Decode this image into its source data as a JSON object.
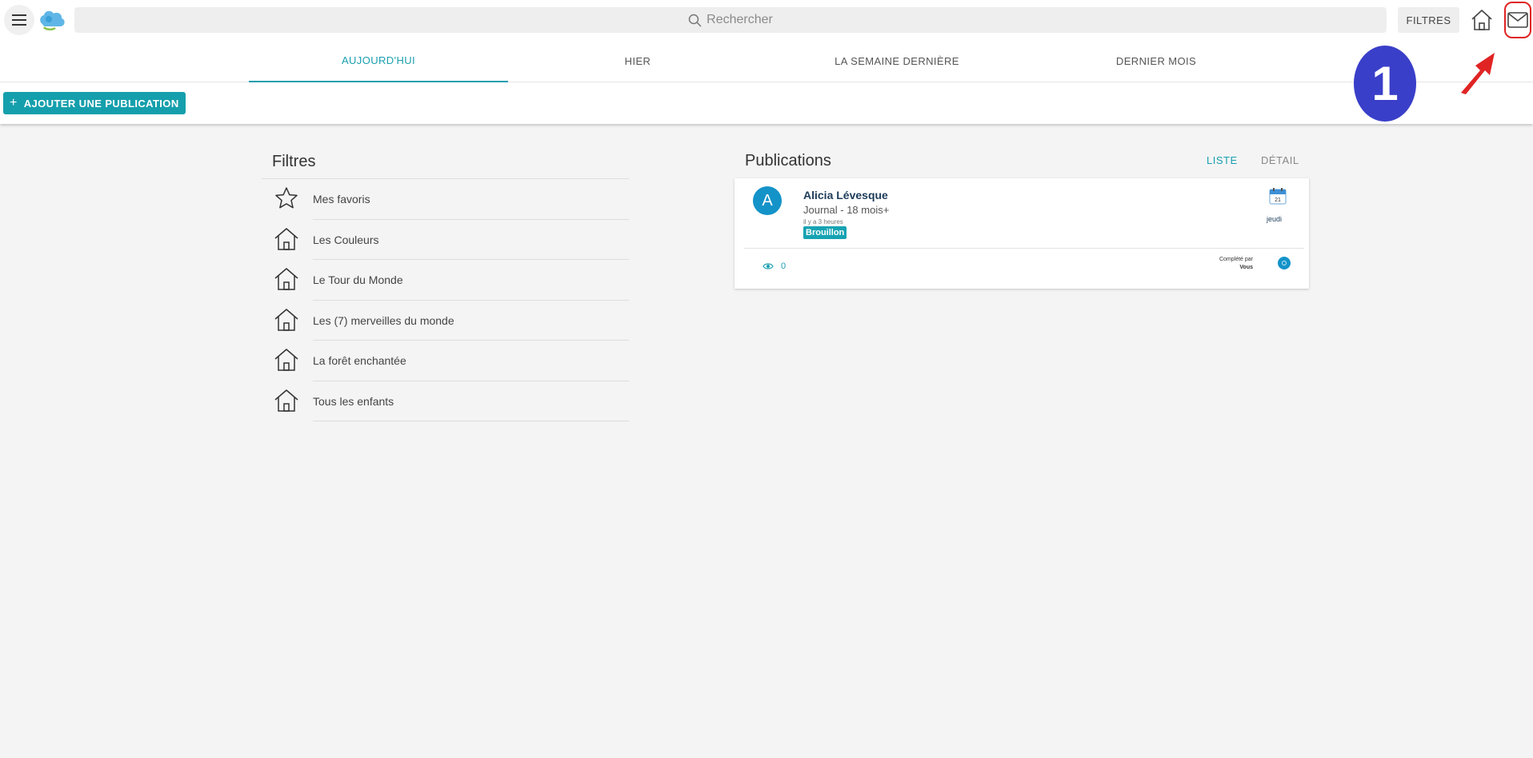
{
  "header": {
    "search_placeholder": "Rechercher",
    "filters_button": "FILTRES",
    "icons": [
      "menu-icon",
      "app-logo",
      "search-icon",
      "home-icon",
      "mail-icon"
    ]
  },
  "tabs": [
    {
      "label": "AUJOURD'HUI",
      "active": true
    },
    {
      "label": "HIER",
      "active": false
    },
    {
      "label": "LA SEMAINE DERNIÈRE",
      "active": false
    },
    {
      "label": "DERNIER MOIS",
      "active": false
    }
  ],
  "actions": {
    "add_publication": "AJOUTER UNE PUBLICATION"
  },
  "annotation": {
    "step_number": "1",
    "color": "#3a3fc9",
    "arrow_color": "#e02424"
  },
  "filters": {
    "title": "Filtres",
    "items": [
      {
        "label": "Mes favoris",
        "icon": "star-icon"
      },
      {
        "label": "Les Couleurs",
        "icon": "home-icon"
      },
      {
        "label": "Le Tour du Monde",
        "icon": "home-icon"
      },
      {
        "label": "Les (7) merveilles du monde",
        "icon": "home-icon"
      },
      {
        "label": "La forêt enchantée",
        "icon": "home-icon"
      },
      {
        "label": "Tous les enfants",
        "icon": "home-icon"
      }
    ]
  },
  "publications": {
    "title": "Publications",
    "view_list": "LISTE",
    "view_detail": "DÉTAIL",
    "items": [
      {
        "avatar_letter": "A",
        "author": "Alicia Lévesque",
        "journal": "Journal - 18 mois+",
        "time": "il y a 3 heures",
        "status": "Brouillon",
        "calendar_day": "21",
        "day_label": "jeudi",
        "views": "0",
        "completed_label": "Complété par",
        "completed_by": "Vous"
      }
    ]
  },
  "colors": {
    "accent": "#1a9fb0",
    "button": "#159fac",
    "avatar": "#1493c9"
  }
}
